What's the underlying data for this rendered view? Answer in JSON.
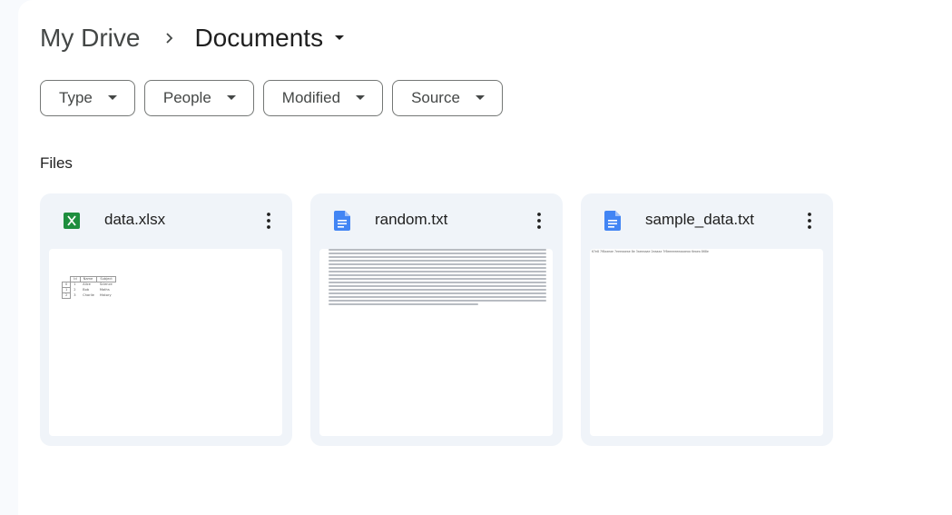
{
  "breadcrumb": {
    "root": "My Drive",
    "current": "Documents"
  },
  "filters": [
    {
      "label": "Type"
    },
    {
      "label": "People"
    },
    {
      "label": "Modified"
    },
    {
      "label": "Source"
    }
  ],
  "section": {
    "title": "Files"
  },
  "files": [
    {
      "name": "data.xlsx",
      "icon": "sheets-icon",
      "icon_color": "#1e8e3e",
      "icon_letter": "X"
    },
    {
      "name": "random.txt",
      "icon": "doc-icon",
      "icon_color": "#4285f4"
    },
    {
      "name": "sample_data.txt",
      "icon": "doc-icon",
      "icon_color": "#4285f4"
    }
  ],
  "xlsx_preview": {
    "header": [
      "Id",
      "Name",
      "Subject"
    ],
    "rows": [
      [
        "0",
        "1",
        "Alice",
        "Science"
      ],
      [
        "1",
        "2",
        "Bob",
        "Maths"
      ],
      [
        "2",
        "3",
        "Charlie",
        "History"
      ]
    ]
  },
  "sample_preview": "67e8 7f8aaeae 7eeeaaeae 8e 3aeeaaae 2eaaaa 7f6eeeeeeeaaaeaa 6eaea 868e",
  "colors": {
    "background": "#f8fafd",
    "card": "#f0f4f9",
    "chip_border": "#747775",
    "text": "#1f1f1f",
    "muted_text": "#444746"
  }
}
